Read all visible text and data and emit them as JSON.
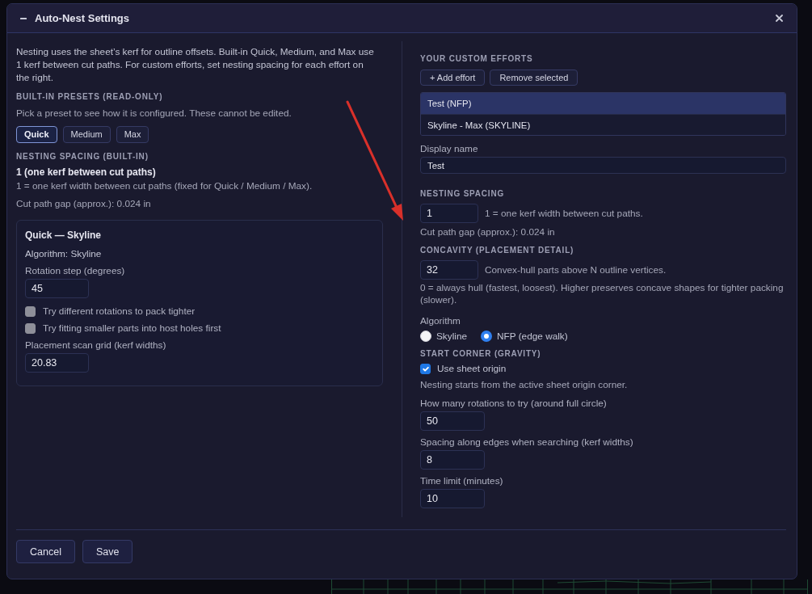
{
  "window": {
    "title": "Auto-Nest Settings"
  },
  "builtin": {
    "intro": "Nesting uses the sheet’s kerf for outline offsets. Built-in Quick, Medium, and Max use 1 kerf between cut paths. For custom efforts, set nesting spacing for each effort on the right.",
    "presets_heading": "BUILT-IN PRESETS (READ-ONLY)",
    "presets_hint": "Pick a preset to see how it is configured. These cannot be edited.",
    "presets": [
      {
        "label": "Quick",
        "selected": true
      },
      {
        "label": "Medium",
        "selected": false
      },
      {
        "label": "Max",
        "selected": false
      }
    ],
    "spacing_heading": "NESTING SPACING (BUILT-IN)",
    "spacing_value": "1 (one kerf between cut paths)",
    "spacing_note": "1 = one kerf width between cut paths (fixed for Quick / Medium / Max).",
    "gap": "Cut path gap (approx.): 0.024 in",
    "card": {
      "title": "Quick — Skyline",
      "algorithm": "Algorithm: Skyline",
      "items": [
        {
          "kind": "number",
          "label": "Rotation step (degrees)",
          "value": "45"
        },
        {
          "kind": "checkbox",
          "label": "Try different rotations to pack tighter",
          "checked": false,
          "disabled": true
        },
        {
          "kind": "checkbox",
          "label": "Try fitting smaller parts into host holes first",
          "checked": false,
          "disabled": true
        },
        {
          "kind": "number",
          "label": "Placement scan grid (kerf widths)",
          "value": "20.83"
        }
      ]
    }
  },
  "custom": {
    "heading": "YOUR CUSTOM EFFORTS",
    "actions": [
      "+ Add effort",
      "Remove selected"
    ],
    "efforts": [
      {
        "label": "Test (NFP)",
        "selected": true
      },
      {
        "label": "Skyline - Max (SKYLINE)",
        "selected": false
      }
    ],
    "display_name": {
      "label": "Display name",
      "value": "Test"
    },
    "spacing": {
      "heading": "NESTING SPACING",
      "value": "1",
      "note": "1 = one kerf width between cut paths.",
      "gap": "Cut path gap (approx.): 0.024 in"
    },
    "concavity": {
      "heading": "CONCAVITY (PLACEMENT DETAIL)",
      "value": "32",
      "note": "Convex-hull parts above N outline vertices.",
      "help": "0 = always hull (fastest, loosest). Higher preserves concave shapes for tighter packing (slower)."
    },
    "algorithm": {
      "label": "Algorithm",
      "options": [
        {
          "label": "Skyline",
          "selected": false
        },
        {
          "label": "NFP (edge walk)",
          "selected": true
        }
      ]
    },
    "start_corner": {
      "heading": "START CORNER (GRAVITY)",
      "checkbox": {
        "label": "Use sheet origin",
        "checked": true
      },
      "help": "Nesting starts from the active sheet origin corner."
    },
    "fields": [
      {
        "label": "How many rotations to try (around full circle)",
        "value": "50"
      },
      {
        "label": "Spacing along edges when searching (kerf widths)",
        "value": "8"
      },
      {
        "label": "Time limit (minutes)",
        "value": "10"
      }
    ]
  },
  "footer": {
    "buttons": [
      "Cancel",
      "Save"
    ]
  }
}
